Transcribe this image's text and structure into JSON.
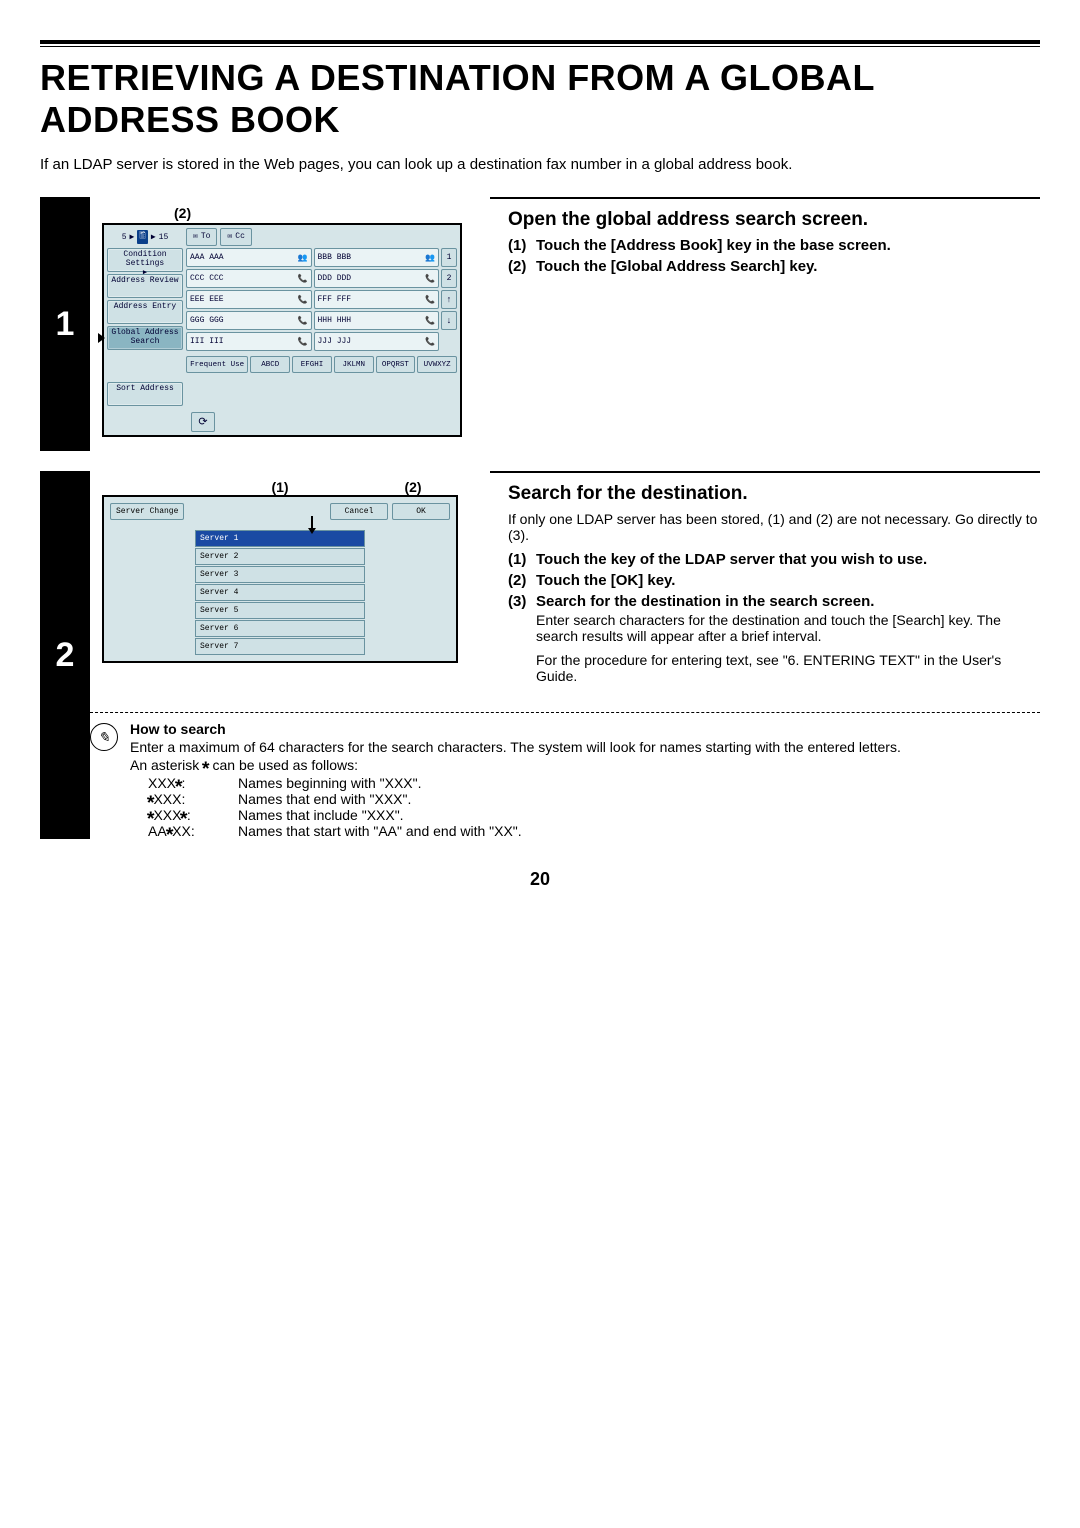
{
  "title": "RETRIEVING A DESTINATION FROM A GLOBAL ADDRESS BOOK",
  "intro": "If an LDAP server is stored in the Web pages, you can look up a destination fax number in a global address book.",
  "page_number": "20",
  "step1": {
    "num": "1",
    "callout": "(2)",
    "heading": "Open the global address search screen.",
    "items": [
      {
        "n": "(1)",
        "text": "Touch the [Address Book] key in the base screen."
      },
      {
        "n": "(2)",
        "text": "Touch the [Global Address Search] key."
      }
    ],
    "panel": {
      "counter_left": "5",
      "counter_right": "15",
      "tab_to": "To",
      "tab_cc": "Cc",
      "sidebar": [
        "Condition Settings",
        "Address Review",
        "Address Entry",
        "Global Address Search"
      ],
      "sort_label": "Sort Address",
      "contacts_left": [
        "AAA AAA",
        "CCC CCC",
        "EEE EEE",
        "GGG GGG",
        "III III"
      ],
      "contacts_right": [
        "BBB BBB",
        "DDD DDD",
        "FFF FFF",
        "HHH HHH",
        "JJJ JJJ"
      ],
      "scroll_nums": [
        "1",
        "2"
      ],
      "up_glyph": "↑",
      "down_glyph": "↓",
      "bottom_tabs": [
        "Frequent Use",
        "ABCD",
        "EFGHI",
        "JKLMN",
        "OPQRST",
        "UVWXYZ"
      ],
      "refresh_glyph": "⟳"
    }
  },
  "step2": {
    "num": "2",
    "callout1": "(1)",
    "callout2": "(2)",
    "heading": "Search for the destination.",
    "pre_note": "If only one LDAP server has been stored, (1) and (2) are not necessary. Go directly to (3).",
    "items": [
      {
        "n": "(1)",
        "text": "Touch the key of the LDAP server that you wish to use."
      },
      {
        "n": "(2)",
        "text": "Touch the [OK] key."
      },
      {
        "n": "(3)",
        "text": "Search for the destination in the search screen."
      }
    ],
    "sub_paras": [
      "Enter search characters for the destination and touch the [Search] key. The search results will appear after a brief interval.",
      "For the procedure for entering text, see \"6. ENTERING TEXT\" in the User's Guide."
    ],
    "panel": {
      "badge": "Server Change",
      "cancel": "Cancel",
      "ok": "OK",
      "servers": [
        "Server 1",
        "Server 2",
        "Server 3",
        "Server 4",
        "Server 5",
        "Server 6",
        "Server 7"
      ]
    },
    "howto": {
      "title": "How to search",
      "line1": "Enter a maximum of 64 characters for the search characters. The system will look for names starting with the entered letters.",
      "line2_pre": "An asterisk ",
      "line2_post": " can be used as follows:",
      "rows": [
        {
          "k": "XXX*:",
          "v": "Names beginning with \"XXX\"."
        },
        {
          "k": "*XXX:",
          "v": "Names that end with \"XXX\"."
        },
        {
          "k": "*XXX*:",
          "v": "Names that include \"XXX\"."
        },
        {
          "k": "AA*XX:",
          "v": "Names that start with \"AA\" and end with \"XX\"."
        }
      ]
    }
  }
}
